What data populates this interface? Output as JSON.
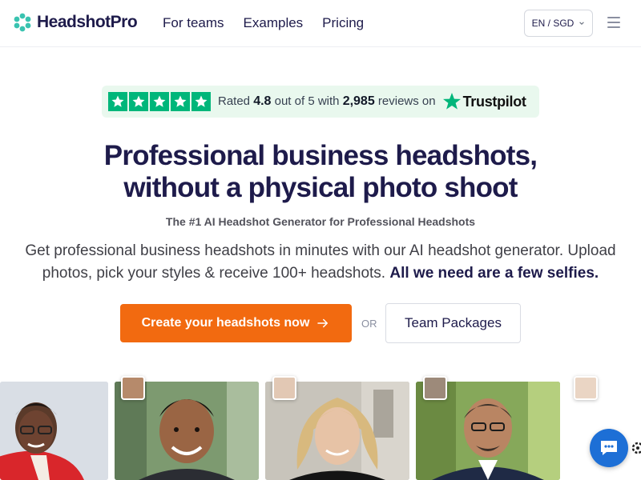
{
  "nav": {
    "brand": "HeadshotPro",
    "links": [
      "For teams",
      "Examples",
      "Pricing"
    ],
    "language": "EN / SGD"
  },
  "trustpilot": {
    "rated_prefix": "Rated",
    "rating": "4.8",
    "out_of": "out of 5 with",
    "count": "2,985",
    "reviews_on": "reviews on",
    "brand": "Trustpilot",
    "star_color": "#00b67a"
  },
  "hero": {
    "title_line1": "Professional business headshots,",
    "title_line2": "without a physical photo shoot",
    "subtitle": "The #1 AI Headshot Generator for Professional Headshots",
    "description": "Get professional business headshots in minutes with our AI headshot generator. Upload photos, pick your styles & receive 100+ headshots.",
    "description_bold": "All we need are a few selfies."
  },
  "cta": {
    "primary_label": "Create your headshots now",
    "or_label": "OR",
    "secondary_label": "Team Packages",
    "accent": "#f26a10"
  },
  "icons": {
    "logo": "headshotpro-logo-icon",
    "language": "chevron-down-icon",
    "menu": "hamburger-menu-icon",
    "arrow": "arrow-right-icon",
    "chat": "chat-bubble-icon",
    "settings": "gear-icon"
  }
}
